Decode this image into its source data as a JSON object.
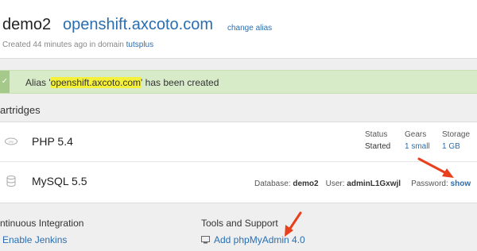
{
  "app": {
    "name": "demo2",
    "url": "openshift.axcoto.com",
    "change_alias": "change alias",
    "created_prefix": "Created 44 minutes ago in domain ",
    "domain": "tutsplus"
  },
  "alert": {
    "text_before": "Alias '",
    "alias": "openshift.axcoto.com",
    "text_after": "' has been created"
  },
  "cartridges": {
    "title": "artridges",
    "php": {
      "name": "PHP 5.4",
      "status_label": "Status",
      "status_value": "Started",
      "gears_label": "Gears",
      "gears_value": "1 small",
      "storage_label": "Storage",
      "storage_value": "1 GB"
    },
    "mysql": {
      "name": "MySQL 5.5",
      "database_label": "Database: ",
      "database_value": "demo2",
      "user_label": "User: ",
      "user_value": "adminL1Gxwjl",
      "password_label": "Password: ",
      "password_link": "show"
    }
  },
  "ci": {
    "title": "ntinuous Integration",
    "link": "Enable Jenkins"
  },
  "tools": {
    "title": "Tools and Support",
    "link": "Add phpMyAdmin 4.0"
  },
  "colors": {
    "link": "#2a6eb0",
    "alert_bg": "#d7ebc8",
    "highlight": "#f5f03a",
    "annotation_arrow": "#e8401c"
  },
  "icons": [
    "check-icon",
    "php-icon",
    "database-icon",
    "tools-icon",
    "annotation-arrow-icon"
  ]
}
